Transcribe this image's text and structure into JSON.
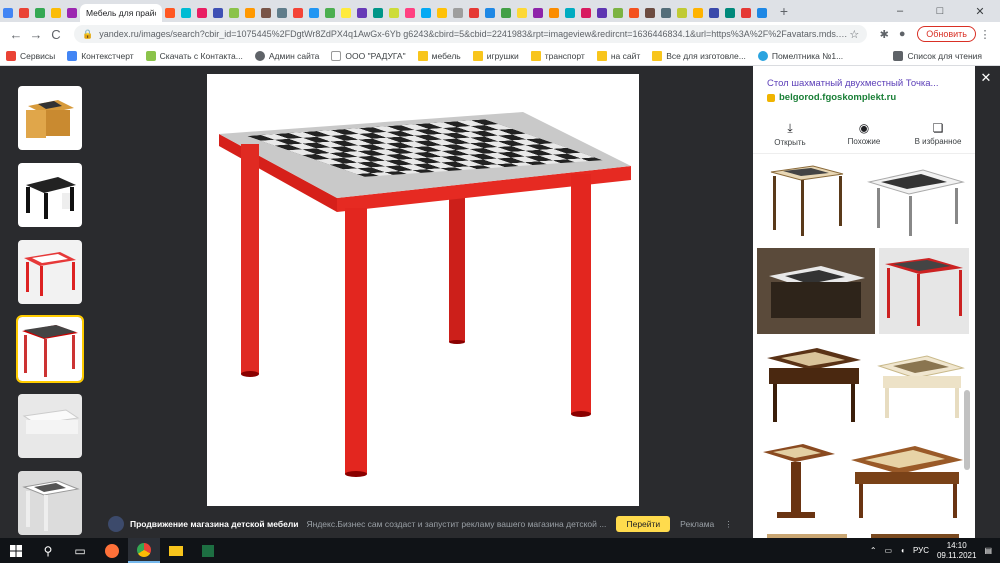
{
  "tabs": {
    "active_title": "Мебель для прайса",
    "favicon_colors": [
      "#4285f4",
      "#ea4335",
      "#34a853",
      "#fbbc05",
      "#9c27b0",
      "#ff5722",
      "#00bcd4",
      "#e91e63",
      "#3f51b5",
      "#8bc34a",
      "#ff9800",
      "#795548",
      "#607d8b",
      "#f44336",
      "#2196f3",
      "#4caf50",
      "#ffeb3b",
      "#673ab7",
      "#009688",
      "#cddc39",
      "#ff4081",
      "#03a9f4",
      "#ffc107",
      "#9e9e9e",
      "#e53935",
      "#1e88e5",
      "#43a047",
      "#fdd835",
      "#8e24aa",
      "#fb8c00",
      "#00acc1",
      "#d81b60",
      "#5e35b1",
      "#7cb342",
      "#f4511e",
      "#6d4c41",
      "#546e7a",
      "#c0ca33",
      "#ffb300",
      "#3949ab",
      "#00897b",
      "#e53935",
      "#1e88e5"
    ],
    "new_tab_label": "+"
  },
  "window": {
    "minimize": "–",
    "maximize": "□",
    "close": "✕"
  },
  "toolbar": {
    "back": "←",
    "forward": "→",
    "reload": "C",
    "url": "yandex.ru/images/search?cbir_id=1075445%2FDgtWr8ZdPX4q1AwGx-6Yb g6243&cbird=5&cbid=2241983&rpt=imageview&redircnt=1636446834.1&url=https%3A%2F%2Favatars.mds.yand...",
    "update_label": "Обновить"
  },
  "bookmarks": {
    "items": [
      "Сервисы",
      "Контекстчерт",
      "Скачать с Контакта...",
      "Админ сайта",
      "ООО \"РАДУГА\"",
      "мебель",
      "игрушки",
      "транспорт",
      "на сайт",
      "Все для изготовле...",
      "Помелтника №1..."
    ],
    "right": "Список для чтения"
  },
  "ad": {
    "title": "Продвижение магазина детской мебели",
    "text": "Яндекс.Бизнес сам создаст и запустит рекламу вашего магазина детской ...",
    "button": "Перейти",
    "label": "Реклама"
  },
  "panel": {
    "title": "Стол шахматный двухместный Точка...",
    "domain": "belgorod.fgoskomplekt.ru",
    "actions": [
      {
        "icon": "⤓",
        "label": "Открыть"
      },
      {
        "icon": "◉",
        "label": "Похожие"
      },
      {
        "icon": "❏",
        "label": "В избранное"
      }
    ]
  },
  "taskbar": {
    "lang": "РУС",
    "time": "14:10",
    "date": "09.11.2021"
  }
}
